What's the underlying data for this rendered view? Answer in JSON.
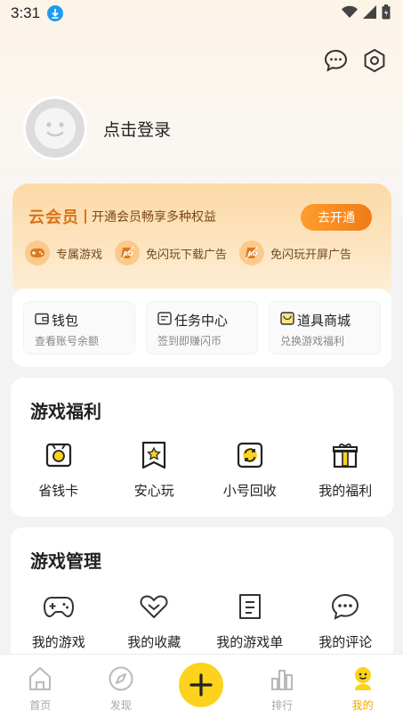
{
  "status": {
    "time": "3:31"
  },
  "profile": {
    "login_text": "点击登录"
  },
  "vip": {
    "title": "云会员",
    "desc": "开通会员畅享多种权益",
    "button": "去开通",
    "perks": [
      {
        "label": "专属游戏",
        "icon": "gamepad-icon"
      },
      {
        "label": "免闪玩下载广告",
        "icon": "no-ad-icon"
      },
      {
        "label": "免闪玩开屏广告",
        "icon": "no-ad-icon"
      }
    ]
  },
  "wallet": {
    "items": [
      {
        "title": "钱包",
        "sub": "查看账号余额",
        "icon": "wallet-icon"
      },
      {
        "title": "任务中心",
        "sub": "签到即赚闪币",
        "icon": "task-icon"
      },
      {
        "title": "道具商城",
        "sub": "兑换游戏福利",
        "icon": "shop-icon"
      }
    ]
  },
  "welfare": {
    "title": "游戏福利",
    "items": [
      {
        "label": "省钱卡",
        "icon": "coin-card-icon"
      },
      {
        "label": "安心玩",
        "icon": "star-badge-icon"
      },
      {
        "label": "小号回收",
        "icon": "recycle-icon"
      },
      {
        "label": "我的福利",
        "icon": "gift-icon"
      }
    ]
  },
  "manage": {
    "title": "游戏管理",
    "items": [
      {
        "label": "我的游戏",
        "icon": "gamepad-icon"
      },
      {
        "label": "我的收藏",
        "icon": "heart-icon"
      },
      {
        "label": "我的游戏单",
        "icon": "list-icon"
      },
      {
        "label": "我的评论",
        "icon": "comment-icon"
      }
    ]
  },
  "tabs": [
    {
      "label": "首页",
      "icon": "home-icon"
    },
    {
      "label": "发现",
      "icon": "compass-icon"
    },
    {
      "label": "",
      "icon": "plus-icon"
    },
    {
      "label": "排行",
      "icon": "ranking-icon"
    },
    {
      "label": "我的",
      "icon": "profile-icon"
    }
  ],
  "colors": {
    "accent": "#f4a300",
    "vip_orange": "#d9731b",
    "fab_yellow": "#fcd21c"
  }
}
